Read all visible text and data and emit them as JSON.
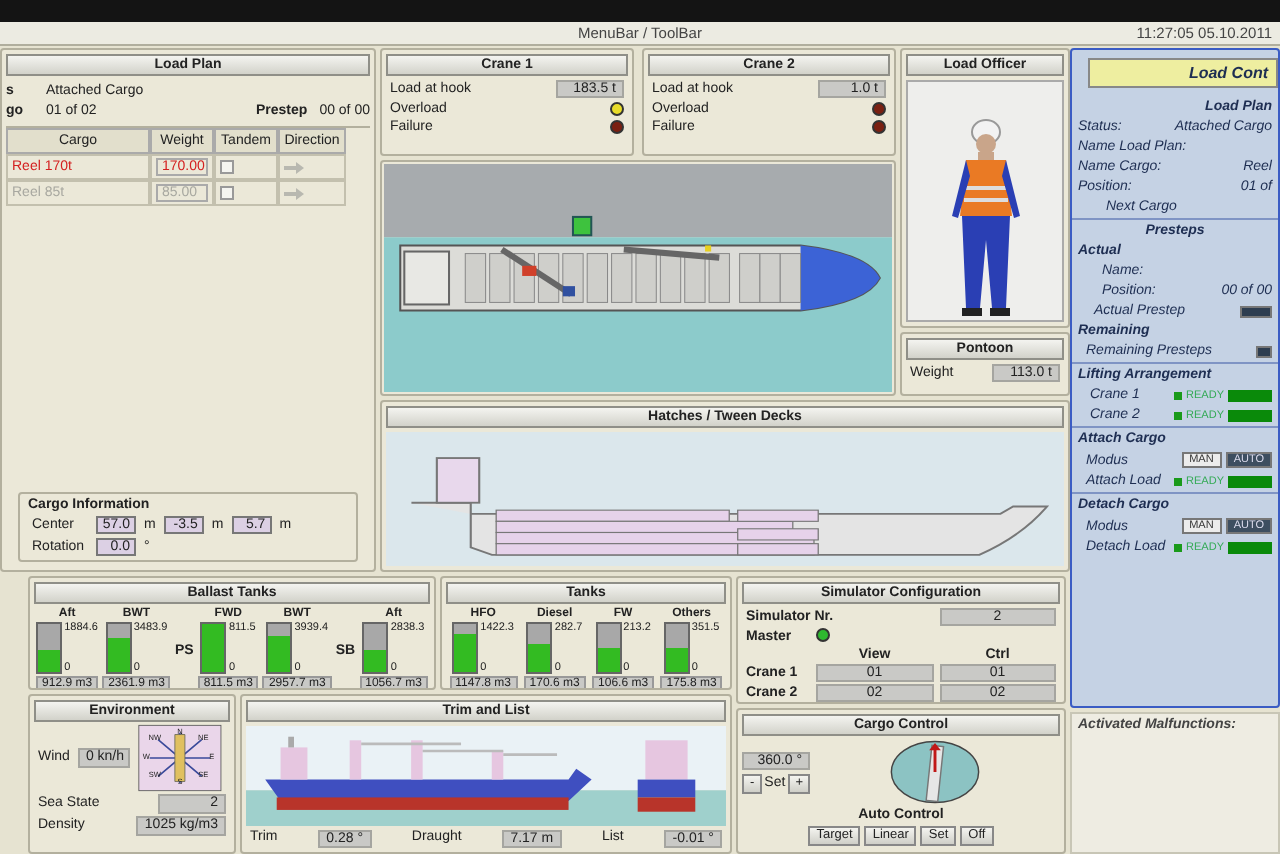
{
  "title_bar": {
    "title": "MenuBar / ToolBar",
    "datetime": "11:27:05  05.10.2011"
  },
  "load_plan": {
    "title": "Load Plan",
    "status_label": "s",
    "status": "Attached Cargo",
    "cargo_label": "go",
    "cargo_position": "01 of 02",
    "prestep_label": "Prestep",
    "prestep_position": "00 of 00",
    "table": {
      "columns": [
        "Cargo",
        "Weight",
        "Tandem",
        "Direction"
      ],
      "rows": [
        {
          "cargo": "Reel 170t",
          "weight": "170.00",
          "tandem": false,
          "selected": true
        },
        {
          "cargo": "Reel 85t",
          "weight": "85.00",
          "tandem": false,
          "selected": false
        }
      ]
    },
    "cargo_information": {
      "title": "Cargo Information",
      "center_label": "Center",
      "center": [
        {
          "value": "57.0",
          "unit": "m"
        },
        {
          "value": "-3.5",
          "unit": "m"
        },
        {
          "value": "5.7",
          "unit": "m"
        }
      ],
      "rotation_label": "Rotation",
      "rotation": {
        "value": "0.0",
        "unit": "°"
      }
    }
  },
  "cranes": [
    {
      "title": "Crane 1",
      "load_label": "Load at hook",
      "load": "183.5 t",
      "lights": [
        {
          "label": "Overload",
          "on": true
        },
        {
          "label": "Failure",
          "on": false
        }
      ]
    },
    {
      "title": "Crane 2",
      "load_label": "Load at hook",
      "load": "1.0 t",
      "lights": [
        {
          "label": "Overload",
          "on": false
        },
        {
          "label": "Failure",
          "on": false
        }
      ]
    }
  ],
  "load_officer": {
    "title": "Load Officer"
  },
  "pontoon": {
    "title": "Pontoon",
    "weight_label": "Weight",
    "weight": "113.0 t"
  },
  "hatches": {
    "title": "Hatches / Tween Decks"
  },
  "load_control": {
    "title": "Load Cont",
    "plan_title": "Load Plan",
    "fields": [
      {
        "label": "Status:",
        "value": "Attached Cargo"
      },
      {
        "label": "Name Load Plan:"
      },
      {
        "label": "Name Cargo:",
        "value": "Reel"
      },
      {
        "label": "Position:",
        "value": "01 of"
      }
    ],
    "next_button": "Next Cargo",
    "presteps": {
      "title": "Presteps",
      "actual_title": "Actual",
      "name_label": "Name:",
      "position_label": "Position:",
      "position": "00 of 00",
      "actual_prestep_label": "Actual Prestep",
      "remaining_title": "Remaining",
      "remaining_label": "Remaining Presteps"
    },
    "lifting": {
      "title": "Lifting Arrangement",
      "rows": [
        {
          "label": "Crane 1",
          "status": "READY",
          "ready": true
        },
        {
          "label": "Crane 2",
          "status": "READY",
          "ready": true
        }
      ]
    },
    "sections": [
      {
        "title": "Attach Cargo",
        "modus_label": "Modus",
        "modes": [
          {
            "label": "MAN",
            "selected": false
          },
          {
            "label": "AUTO",
            "selected": true
          }
        ],
        "load_label": "Attach Load",
        "status": "READY",
        "ready": true
      },
      {
        "title": "Detach Cargo",
        "modus_label": "Modus",
        "modes": [
          {
            "label": "MAN",
            "selected": false
          },
          {
            "label": "AUTO",
            "selected": true
          }
        ],
        "load_label": "Detach Load",
        "status": "READY",
        "ready": true
      }
    ]
  },
  "malfunctions": {
    "title": "Activated Malfunctions:"
  },
  "ballast_tanks": {
    "title": "Ballast Tanks",
    "items": [
      {
        "kind": "tank",
        "name": "Aft",
        "max": "1884.6",
        "min": "0",
        "level": 0.45,
        "volume": "912.9 m3"
      },
      {
        "kind": "tank",
        "name": "BWT",
        "max": "3483.9",
        "min": "0",
        "level": 0.7,
        "volume": "2361.9 m3"
      },
      {
        "kind": "side",
        "text": "PS"
      },
      {
        "kind": "tank",
        "name": "FWD",
        "max": "811.5",
        "min": "0",
        "level": 1.0,
        "volume": "811.5 m3"
      },
      {
        "kind": "tank",
        "name": "BWT",
        "max": "3939.4",
        "min": "0",
        "level": 0.75,
        "volume": "2957.7 m3"
      },
      {
        "kind": "side",
        "text": "SB"
      },
      {
        "kind": "tank",
        "name": "Aft",
        "max": "2838.3",
        "min": "0",
        "level": 0.45,
        "volume": "1056.7 m3"
      }
    ]
  },
  "tanks": {
    "title": "Tanks",
    "items": [
      {
        "kind": "tank",
        "name": "HFO",
        "max": "1422.3",
        "min": "0",
        "level": 0.8,
        "volume": "1147.8 m3"
      },
      {
        "kind": "tank",
        "name": "Diesel",
        "max": "282.7",
        "min": "0",
        "level": 0.6,
        "volume": "170.6 m3"
      },
      {
        "kind": "tank",
        "name": "FW",
        "max": "213.2",
        "min": "0",
        "level": 0.5,
        "volume": "106.6 m3"
      },
      {
        "kind": "tank",
        "name": "Others",
        "max": "351.5",
        "min": "0",
        "level": 0.5,
        "volume": "175.8 m3"
      }
    ]
  },
  "simulator": {
    "title": "Simulator Configuration",
    "nr_label": "Simulator Nr.",
    "nr": "2",
    "master_label": "Master",
    "master": true,
    "columns": [
      "View",
      "Ctrl"
    ],
    "rows": [
      {
        "label": "Crane 1",
        "view": "01",
        "ctrl": "01"
      },
      {
        "label": "Crane 2",
        "view": "02",
        "ctrl": "02"
      }
    ]
  },
  "environment": {
    "title": "Environment",
    "wind_label": "Wind",
    "wind": "0 kn/h",
    "compass": [
      "N",
      "NE",
      "E",
      "SE",
      "S",
      "SW",
      "W",
      "NW"
    ],
    "sea_state_label": "Sea State",
    "sea_state": "2",
    "density_label": "Density",
    "density": "1025 kg/m3"
  },
  "trim_list": {
    "title": "Trim and List",
    "trim_label": "Trim",
    "trim": "0.28 °",
    "draught_label": "Draught",
    "draught": "7.17 m",
    "list_label": "List",
    "list": "-0.01 °"
  },
  "cargo_control": {
    "title": "Cargo Control",
    "heading": "360.0 °",
    "minus": "-",
    "set": "Set",
    "plus": "+",
    "auto_label": "Auto Control",
    "buttons": [
      "Target",
      "Linear",
      "Set",
      "Off"
    ]
  }
}
